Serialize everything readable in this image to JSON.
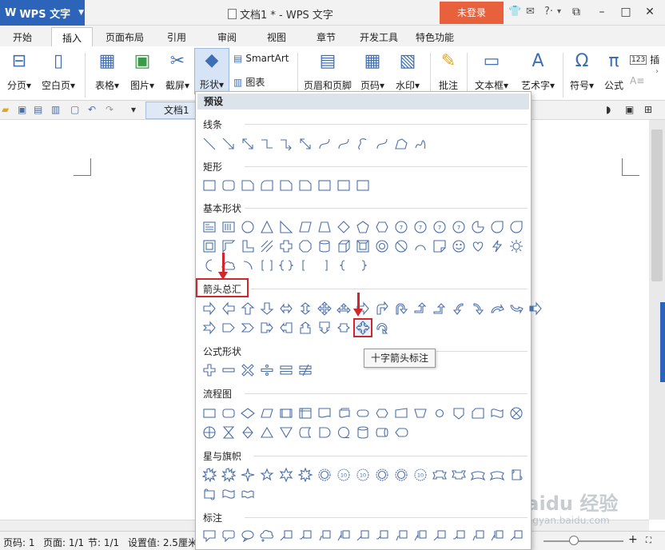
{
  "titlebar": {
    "app_name": "WPS 文字",
    "doc_title": "文档1 * - WPS 文字",
    "login": "未登录"
  },
  "menu_tabs": [
    "开始",
    "插入",
    "页面布局",
    "引用",
    "审阅",
    "视图",
    "章节",
    "开发工具",
    "特色功能"
  ],
  "ribbon": {
    "page_break": "分页",
    "blank_page": "空白页",
    "table": "表格",
    "picture": "图片",
    "screenshot": "截屏",
    "shapes": "形状",
    "smartart": "SmartArt",
    "chart": "图表",
    "header_footer": "页眉和页脚",
    "page_number": "页码",
    "watermark": "水印",
    "comment": "批注",
    "textbox": "文本框",
    "wordart": "艺术字",
    "symbol": "符号",
    "formula": "公式",
    "insert_more": "插"
  },
  "qat": {
    "doc_tab": "文档1"
  },
  "shapes_panel": {
    "header": "预设",
    "categories": {
      "lines": "线条",
      "rectangles": "矩形",
      "basic": "基本形状",
      "arrows": "箭头总汇",
      "equation": "公式形状",
      "flowchart": "流程图",
      "stars": "星与旗帜",
      "callouts": "标注"
    },
    "tooltip": "十字箭头标注"
  },
  "statusbar": {
    "page_code": "页码: 1",
    "page": "页面: 1/1",
    "section": "节: 1/1",
    "setting": "设置值: 2.5厘米"
  },
  "watermark": {
    "main": "Baidu 经验",
    "sub": "jingyan.baidu.com"
  },
  "colors": {
    "brand_blue": "#2b64b8",
    "login_orange": "#e8603c",
    "annotation_red": "#d0262c",
    "shape_stroke": "#4a6fa8"
  }
}
